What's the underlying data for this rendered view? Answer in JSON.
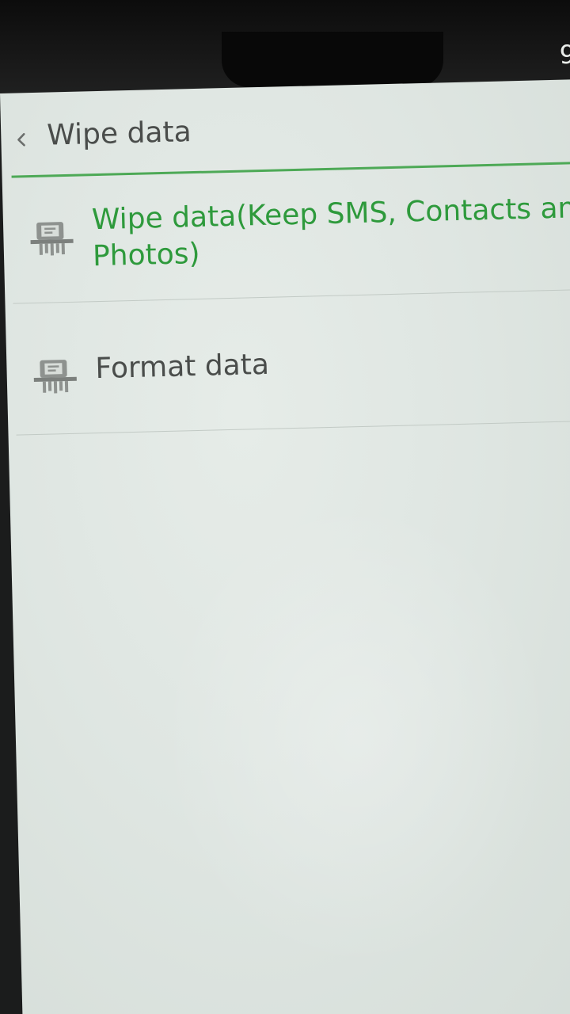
{
  "status_bar": {
    "time": "9"
  },
  "header": {
    "back_icon": "chevron-left-icon",
    "title": "Wipe data"
  },
  "options": [
    {
      "icon": "wipe-icon",
      "label_line1": "Wipe data(Keep SMS, Contacts an",
      "label_line2": "Photos)"
    },
    {
      "icon": "format-icon",
      "label_line1": "Format data"
    }
  ],
  "colors": {
    "accent_green": "#2e9a3c",
    "divider_green": "#4da956",
    "text_gray": "#4a4d4b",
    "background": "#dfe6e2"
  }
}
